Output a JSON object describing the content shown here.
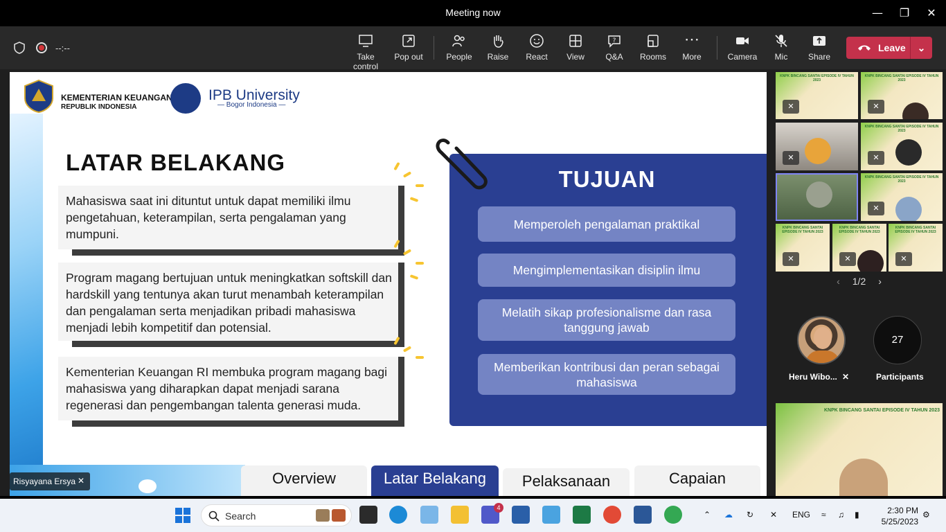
{
  "window": {
    "title": "Meeting now"
  },
  "toolbar": {
    "timer": "--:--",
    "take_control": "Take control",
    "pop_out": "Pop out",
    "people": "People",
    "raise": "Raise",
    "react": "React",
    "view": "View",
    "qa": "Q&A",
    "rooms": "Rooms",
    "more": "More",
    "camera": "Camera",
    "mic": "Mic",
    "share": "Share",
    "leave": "Leave"
  },
  "slide": {
    "org1_line1": "KEMENTERIAN KEUANGAN",
    "org1_line2": "REPUBLIK INDONESIA",
    "org2_line1": "IPB University",
    "org2_line2": "— Bogor Indonesia —",
    "heading_left": "LATAR BELAKANG",
    "paragraphs": [
      "Mahasiswa saat ini dituntut untuk dapat memiliki ilmu pengetahuan, keterampilan, serta pengalaman yang mumpuni.",
      "Program magang bertujuan untuk meningkatkan softskill dan hardskill yang tentunya akan turut menambah keterampilan dan pengalaman serta menjadikan pribadi mahasiswa menjadi lebih kompetitif dan potensial.",
      "Kementerian Keuangan RI membuka program magang bagi mahasiswa yang diharapkan dapat menjadi sarana regenerasi dan pengembangan talenta generasi muda."
    ],
    "heading_right": "TUJUAN",
    "goals": [
      "Memperoleh pengalaman praktikal",
      "Mengimplementasikan disiplin ilmu",
      "Melatih sikap profesionalisme dan rasa tanggung jawab",
      "Memberikan kontribusi dan peran sebagai mahasiswa"
    ],
    "tabs": [
      "Overview",
      "Latar Belakang",
      "Pelaksanaan",
      "Capaian"
    ],
    "active_tab": "Latar Belakang"
  },
  "presenter": {
    "name": "Risyayana Ersya"
  },
  "gallery": {
    "tile_caption": "KNPK BINCANG SANTAI EPISODE IV TAHUN 2023",
    "page": "1/2",
    "attendee_name": "Heru Wibo...",
    "participant_count": "27",
    "participants_label": "Participants"
  },
  "taskbar": {
    "search_placeholder": "Search",
    "teams_badge": "4",
    "language": "ENG",
    "time": "2:30 PM",
    "date": "5/25/2023"
  },
  "colors": {
    "accent_navy": "#2a3f92",
    "leave_red": "#c4314b",
    "pill": "#7484c4"
  }
}
